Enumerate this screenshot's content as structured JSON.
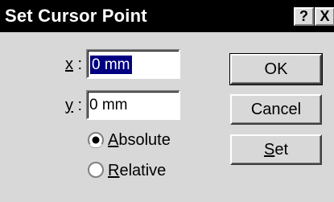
{
  "dialog": {
    "title": "Set Cursor Point",
    "help_glyph": "?",
    "close_glyph": "X"
  },
  "x_field": {
    "label_letter": "x",
    "label_rest": " :",
    "value": "0 mm"
  },
  "y_field": {
    "label_letter": "y",
    "label_rest": " :",
    "value": "0 mm"
  },
  "mode": {
    "options": [
      {
        "first": "A",
        "rest": "bsolute",
        "selected": true
      },
      {
        "first": "R",
        "rest": "elative",
        "selected": false
      }
    ]
  },
  "buttons": {
    "ok": "OK",
    "cancel": "Cancel",
    "set_first": "S",
    "set_rest": "et"
  },
  "colors": {
    "titlebar": "#000000",
    "face": "#d8d8d8",
    "selection": "#000080"
  }
}
